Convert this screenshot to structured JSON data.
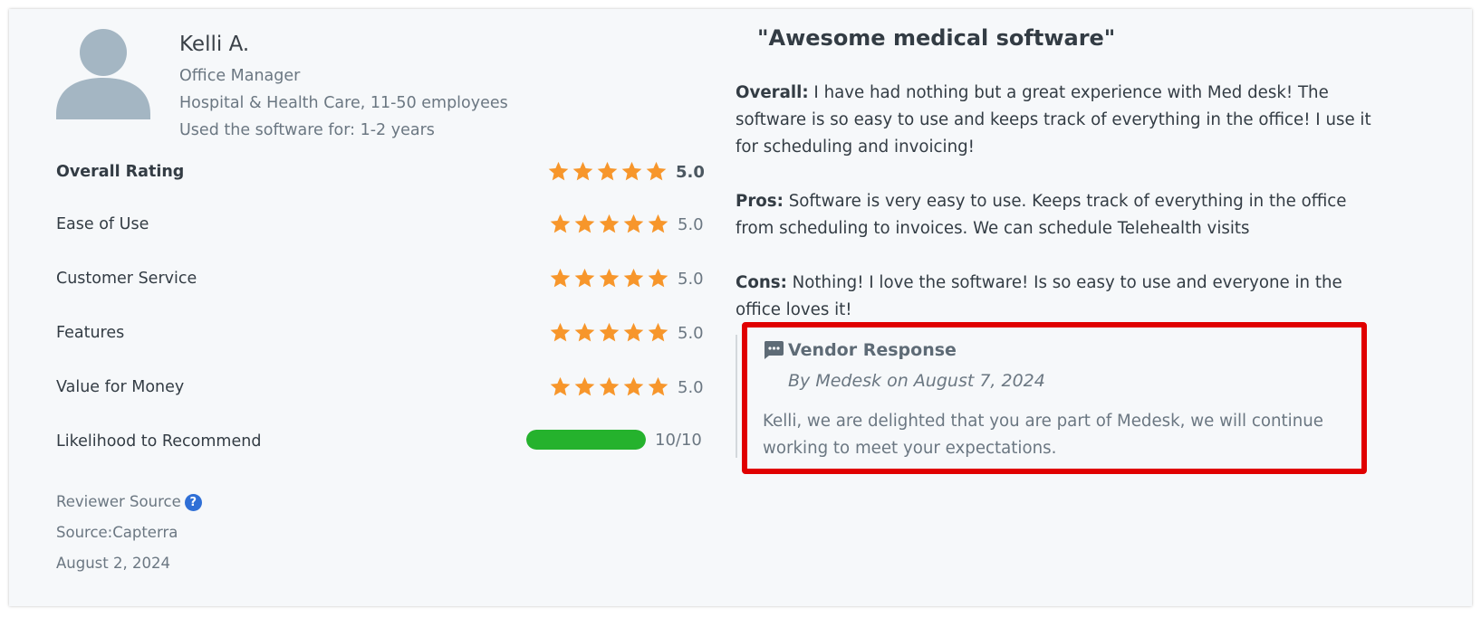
{
  "reviewer": {
    "name": "Kelli A.",
    "role": "Office Manager",
    "company": "Hospital & Health Care, 11-50 employees",
    "usage": "Used the software for: 1-2 years"
  },
  "ratings": [
    {
      "label": "Overall Rating",
      "value": 5.0,
      "display": "5.0"
    },
    {
      "label": "Ease of Use",
      "value": 5.0,
      "display": "5.0"
    },
    {
      "label": "Customer Service",
      "value": 5.0,
      "display": "5.0"
    },
    {
      "label": "Features",
      "value": 5.0,
      "display": "5.0"
    },
    {
      "label": "Value for Money",
      "value": 5.0,
      "display": "5.0"
    }
  ],
  "recommend": {
    "label": "Likelihood to Recommend",
    "value": 10,
    "max": 10,
    "display": "10/10"
  },
  "source": {
    "label": "Reviewer Source",
    "help_glyph": "?",
    "source": "Source:Capterra",
    "date": "August 2, 2024"
  },
  "review": {
    "title": "\"Awesome medical software\"",
    "overall_label": "Overall:",
    "overall_text": " I have had nothing but a great experience with Med desk! The software is so easy to use and keeps track of everything in the office! I use it for scheduling and invoicing!",
    "pros_label": "Pros:",
    "pros_text": " Software is very easy to use. Keeps track of everything in the office from scheduling to invoices. We can schedule Telehealth visits",
    "cons_label": "Cons:",
    "cons_text": " Nothing! I love the software! Is so easy to use and everyone in the office loves it!"
  },
  "vendor": {
    "title": "Vendor Response",
    "by": "By Medesk on August 7, 2024",
    "text": "Kelli, we are delighted that you are part of Medesk, we will continue working to meet your expectations."
  },
  "colors": {
    "star": "#f7962b",
    "recommend_bar": "#25b22d",
    "highlight_border": "#e00000",
    "avatar": "#a4b6c3"
  },
  "icons": [
    "avatar-icon",
    "star-icon",
    "question-circle-icon",
    "chat-bubble-icon"
  ]
}
